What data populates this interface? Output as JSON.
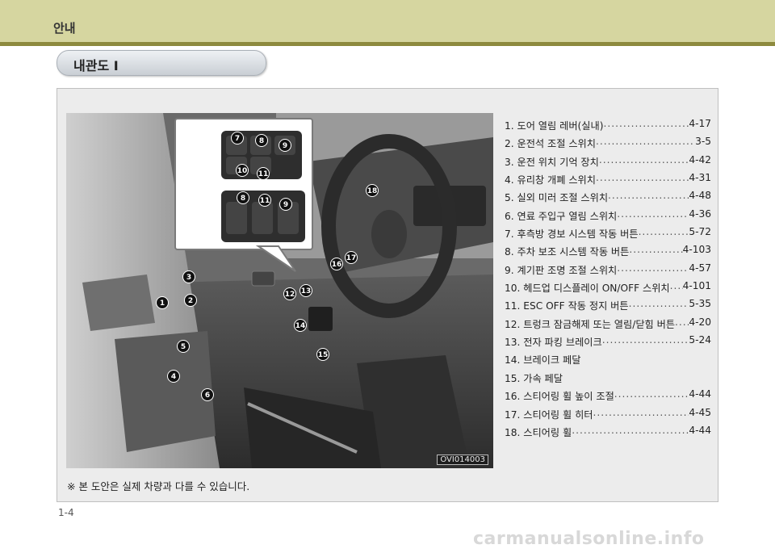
{
  "header": {
    "title": "안내"
  },
  "section": {
    "title": "내관도 I"
  },
  "photo": {
    "code": "OVI014003"
  },
  "markers": [
    "1",
    "2",
    "3",
    "4",
    "5",
    "6",
    "7",
    "8",
    "9",
    "10",
    "11",
    "12",
    "13",
    "14",
    "15",
    "16",
    "17",
    "18"
  ],
  "callout": {
    "top_markers": [
      "7",
      "8",
      "9",
      "10",
      "11"
    ],
    "bottom_markers": [
      "8",
      "11",
      "9"
    ]
  },
  "legend": [
    {
      "label": "1.  도어 열림 레버(실내)",
      "page": "4-17"
    },
    {
      "label": "2.  운전석 조절 스위치",
      "page": "3-5"
    },
    {
      "label": "3.  운전 위치 기억 장치",
      "page": "4-42"
    },
    {
      "label": "4.  유리창 개폐 스위치",
      "page": "4-31"
    },
    {
      "label": "5.  실외 미러 조절 스위치",
      "page": "4-48"
    },
    {
      "label": "6.  연료 주입구 열림 스위치",
      "page": "4-36"
    },
    {
      "label": "7.  후측방 경보 시스템 작동 버튼",
      "page": "5-72"
    },
    {
      "label": "8.  주차 보조 시스템 작동 버튼",
      "page": "4-103"
    },
    {
      "label": "9.  계기판 조명 조절 스위치",
      "page": "4-57"
    },
    {
      "label": "10. 헤드업 디스플레이 ON/OFF 스위치",
      "page": "4-101"
    },
    {
      "label": "11. ESC OFF 작동 정지 버튼",
      "page": "5-35"
    },
    {
      "label": "12. 트렁크 잠금해제 또는 열림/닫힘 버튼",
      "page": "4-20"
    },
    {
      "label": "13. 전자 파킹 브레이크",
      "page": "5-24"
    },
    {
      "label": "14. 브레이크 페달",
      "page": ""
    },
    {
      "label": "15. 가속 페달",
      "page": ""
    },
    {
      "label": "16. 스티어링 휠 높이 조절",
      "page": "4-44"
    },
    {
      "label": "17. 스티어링 휠 히터",
      "page": "4-45"
    },
    {
      "label": "18. 스티어링 휠",
      "page": "4-44"
    }
  ],
  "note": "※ 본 도안은 실제 차량과 다를 수 있습니다.",
  "page_number": "1-4",
  "watermark": "carmanualsonline.info"
}
